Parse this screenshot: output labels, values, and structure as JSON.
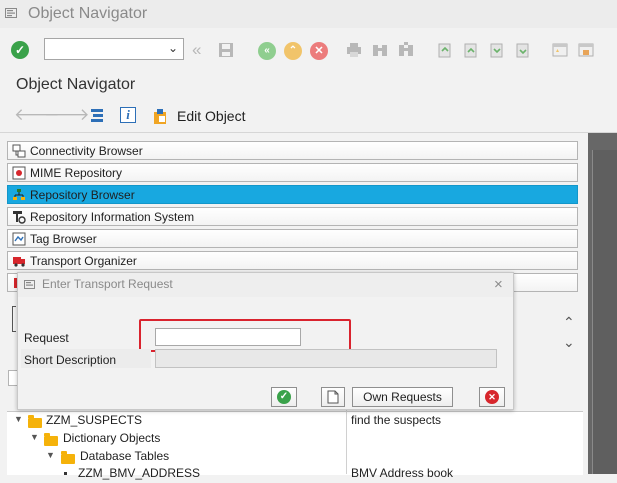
{
  "window": {
    "title": "Object Navigator"
  },
  "page": {
    "title": "Object Navigator"
  },
  "app_toolbar": {
    "edit_object_label": "Edit Object"
  },
  "nav_buttons": [
    {
      "label": "Connectivity Browser"
    },
    {
      "label": "MIME Repository"
    },
    {
      "label": "Repository Browser",
      "selected": true
    },
    {
      "label": "Repository Information System"
    },
    {
      "label": "Tag Browser"
    },
    {
      "label": "Transport Organizer"
    }
  ],
  "dialog": {
    "title": "Enter Transport Request",
    "request_label": "Request",
    "request_value": "",
    "short_description_label": "Short Description",
    "short_description_value": "",
    "own_requests_label": "Own Requests"
  },
  "tree": {
    "rows": [
      {
        "name": "ZZM_SUSPECTS",
        "description": "find the suspects"
      },
      {
        "name": "Dictionary Objects",
        "description": ""
      },
      {
        "name": "Database Tables",
        "description": ""
      },
      {
        "name": "ZZM_BMV_ADDRESS",
        "description": "BMV Address book"
      }
    ]
  },
  "colors": {
    "selected": "#18a8e0",
    "highlight_border": "#d9232e",
    "ok_green": "#3aa24a",
    "cancel_red": "#d7262c",
    "folder": "#f5b20a"
  }
}
